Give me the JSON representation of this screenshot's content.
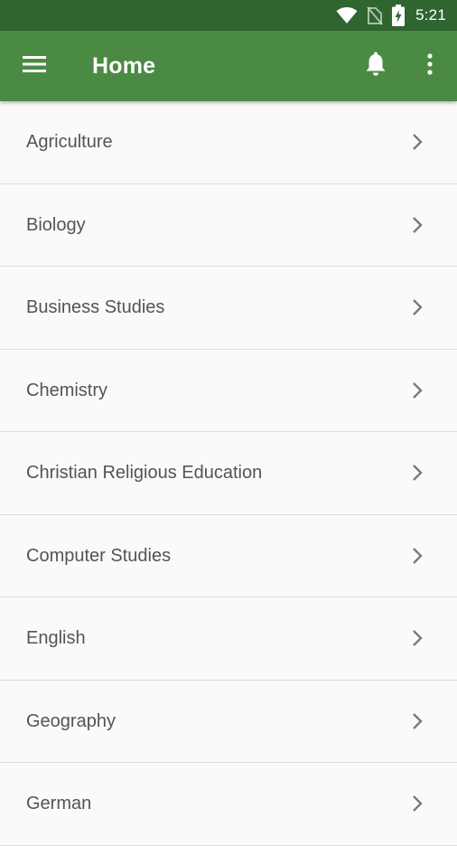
{
  "status_bar": {
    "time": "5:21",
    "icons": [
      "wifi-icon",
      "no-sim-icon",
      "battery-charging-icon"
    ]
  },
  "app_bar": {
    "title": "Home",
    "menu_icon": "hamburger-menu-icon",
    "notification_icon": "bell-icon",
    "overflow_icon": "more-vert-icon",
    "color": "#4b8a43",
    "status_color": "#2f6530"
  },
  "subjects": [
    {
      "label": "Agriculture"
    },
    {
      "label": "Biology"
    },
    {
      "label": "Business Studies"
    },
    {
      "label": "Chemistry"
    },
    {
      "label": "Christian Religious Education"
    },
    {
      "label": "Computer Studies"
    },
    {
      "label": "English"
    },
    {
      "label": "Geography"
    },
    {
      "label": "German"
    }
  ],
  "list_item_icon": "chevron-right-icon"
}
